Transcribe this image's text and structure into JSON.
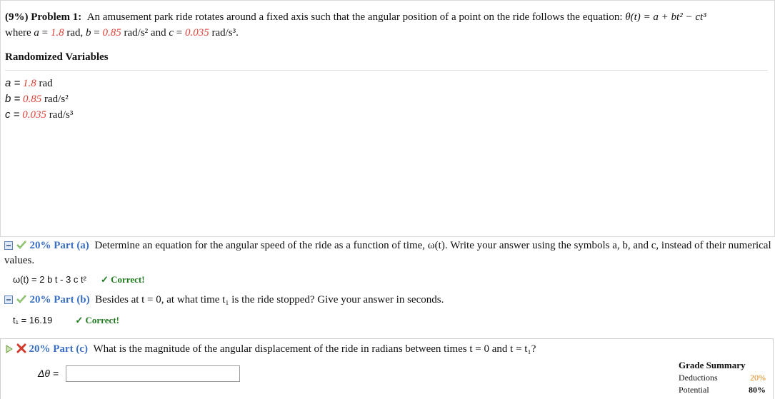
{
  "problem": {
    "weight": "(9%)",
    "label": "Problem 1:",
    "statement": "An amusement park ride rotates around a fixed axis such that the angular position of a point on the ride follows the equation:",
    "equation": "θ(t) = a + bt² − ct³",
    "where_prefix": "where",
    "a_value": "1.8",
    "a_unit": "rad",
    "b_value": "0.85",
    "b_unit": "rad/s²",
    "and_word": "and",
    "c_value": "0.035",
    "c_unit": "rad/s³."
  },
  "randomized": {
    "title": "Randomized Variables",
    "rows": [
      {
        "sym": "a =",
        "value": "1.8",
        "unit": "rad"
      },
      {
        "sym": "b =",
        "value": "0.85",
        "unit": "rad/s²"
      },
      {
        "sym": "c =",
        "value": "0.035",
        "unit": "rad/s³"
      }
    ]
  },
  "parts": {
    "a": {
      "label": "20% Part (a)",
      "text": "Determine an equation for the angular speed of the ride as a function of time, ω(t). Write your answer using the symbols a, b, and c, instead of their numerical values.",
      "answer": "ω(t) = 2 b t - 3 c t²",
      "status": "✓ Correct!"
    },
    "b": {
      "label": "20% Part (b)",
      "text": "Besides at t = 0, at what time t₁ is the ride stopped? Give your answer in seconds.",
      "answer": "t₁ = 16.19",
      "status": "✓ Correct!"
    },
    "c": {
      "label": "20% Part (c)",
      "text": "What is the magnitude of the angular displacement of the ride in radians between times t = 0 and t = t₁?",
      "input_label": "Δθ =",
      "input_value": ""
    }
  },
  "grade_summary": {
    "title": "Grade Summary",
    "deductions_label": "Deductions",
    "deductions_value": "20%",
    "potential_label": "Potential",
    "potential_value": "80%"
  },
  "colors": {
    "variable_red": "#e0443a",
    "part_blue": "#3a6fc4",
    "correct_green": "#1e7a1e",
    "deductions_orange": "#e08a1e"
  }
}
